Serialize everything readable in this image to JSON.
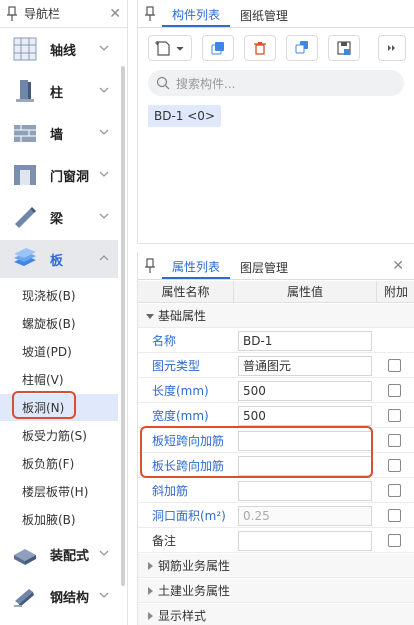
{
  "nav": {
    "title": "导航栏",
    "categories": [
      {
        "label": "轴线",
        "icon": "axis-grid-icon"
      },
      {
        "label": "柱",
        "icon": "column-icon"
      },
      {
        "label": "墙",
        "icon": "wall-icon"
      },
      {
        "label": "门窗洞",
        "icon": "door-window-icon"
      },
      {
        "label": "梁",
        "icon": "beam-icon"
      },
      {
        "label": "板",
        "icon": "slab-icon"
      },
      {
        "label": "装配式",
        "icon": "prefab-icon"
      },
      {
        "label": "钢结构",
        "icon": "steel-structure-icon"
      }
    ],
    "sub_items": [
      "现浇板(B)",
      "螺旋板(B)",
      "坡道(PD)",
      "柱帽(V)",
      "板洞(N)",
      "板受力筋(S)",
      "板负筋(F)",
      "楼层板带(H)",
      "板加腋(B)"
    ]
  },
  "components_panel": {
    "tabs": [
      "构件列表",
      "图纸管理"
    ],
    "search_placeholder": "搜索构件...",
    "item": "BD-1 <0>"
  },
  "props_panel": {
    "tabs": [
      "属性列表",
      "图层管理"
    ],
    "headers": [
      "属性名称",
      "属性值",
      "附加"
    ],
    "group_basic": "基础属性",
    "rows": [
      {
        "name": "名称",
        "value": "BD-1",
        "style": "blue",
        "check": false
      },
      {
        "name": "图元类型",
        "value": "普通图元",
        "style": "blue",
        "check": true
      },
      {
        "name": "长度(mm)",
        "value": "500",
        "style": "blue",
        "check": true
      },
      {
        "name": "宽度(mm)",
        "value": "500",
        "style": "blue",
        "check": true
      },
      {
        "name": "板短跨向加筋",
        "value": "",
        "style": "blue",
        "check": true
      },
      {
        "name": "板长跨向加筋",
        "value": "",
        "style": "blue",
        "check": true
      },
      {
        "name": "斜加筋",
        "value": "",
        "style": "blue",
        "check": true
      },
      {
        "name": "洞口面积(m²)",
        "value": "0.25",
        "style": "blue",
        "check": true,
        "disabled": true
      },
      {
        "name": "备注",
        "value": "",
        "style": "dark",
        "check": true
      }
    ],
    "groups_collapsed": [
      "钢筋业务属性",
      "土建业务属性",
      "显示样式"
    ]
  },
  "colors": {
    "accent": "#2e6bd1",
    "highlight": "#d9502a"
  }
}
